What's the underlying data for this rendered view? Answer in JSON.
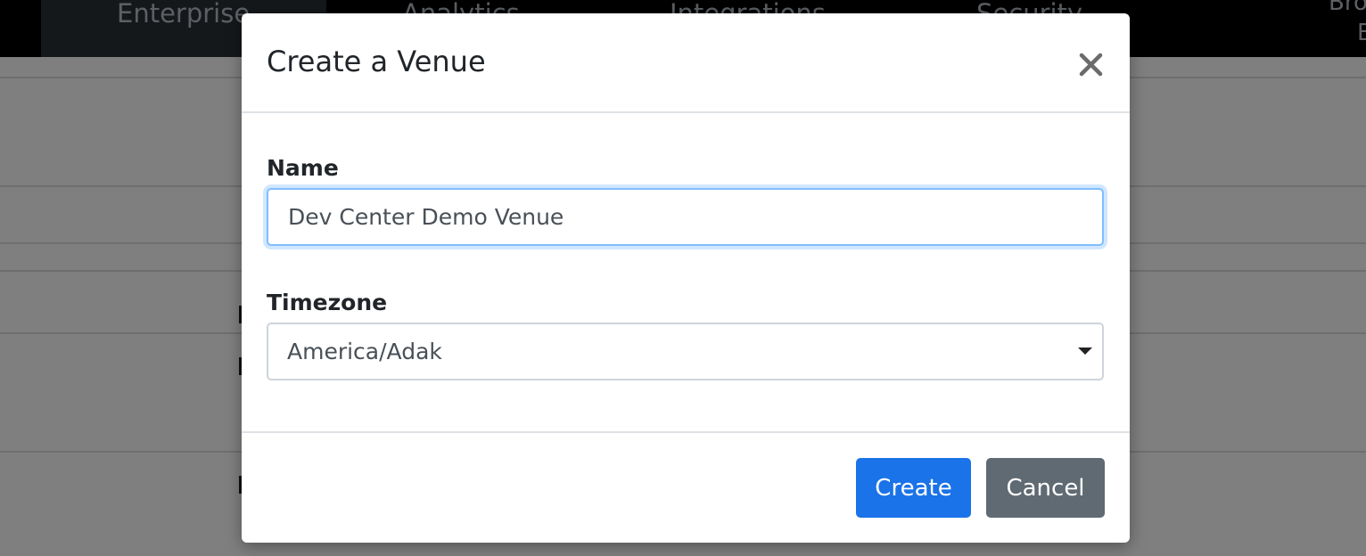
{
  "nav": {
    "tabs": [
      "Enterprise",
      "Analytics",
      "Integrations",
      "Security"
    ],
    "overflow_tab_line1": "Bro",
    "overflow_tab_line2": "B",
    "active_tab": "Enterprise"
  },
  "modal": {
    "title": "Create a Venue",
    "close_icon": "close-icon",
    "name_label": "Name",
    "name_value": "Dev Center Demo Venue",
    "timezone_label": "Timezone",
    "timezone_value": "America/Adak",
    "create_label": "Create",
    "cancel_label": "Cancel"
  },
  "colors": {
    "primary": "#1a73e8",
    "secondary": "#5f6a73",
    "focus_border": "#80bdff"
  }
}
